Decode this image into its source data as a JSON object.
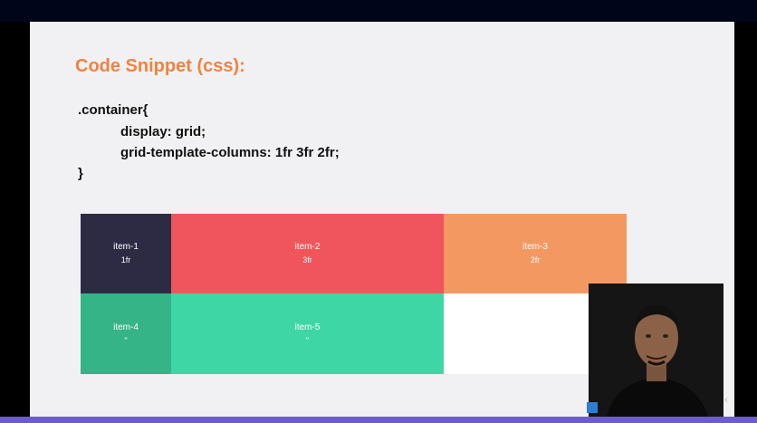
{
  "slide": {
    "title": "Code Snippet (css):",
    "code": [
      ".container{",
      "display: grid;",
      "grid-template-columns: 1fr 3fr 2fr;",
      "}"
    ]
  },
  "grid_items": [
    {
      "label": "item-1",
      "sub": "1fr",
      "color": "#2d2b44"
    },
    {
      "label": "item-2",
      "sub": "3fr",
      "color": "#f0555b"
    },
    {
      "label": "item-3",
      "sub": "2fr",
      "color": "#f49861"
    },
    {
      "label": "item-4",
      "sub": "\"",
      "color": "#35b487"
    },
    {
      "label": "item-5",
      "sub": "\"",
      "color": "#3fd6a5"
    }
  ],
  "colors": {
    "title": "#ef8340",
    "slide_bg": "#f1f1f3",
    "topbar": "#01051a",
    "bottombar": "#6a5bd6"
  }
}
